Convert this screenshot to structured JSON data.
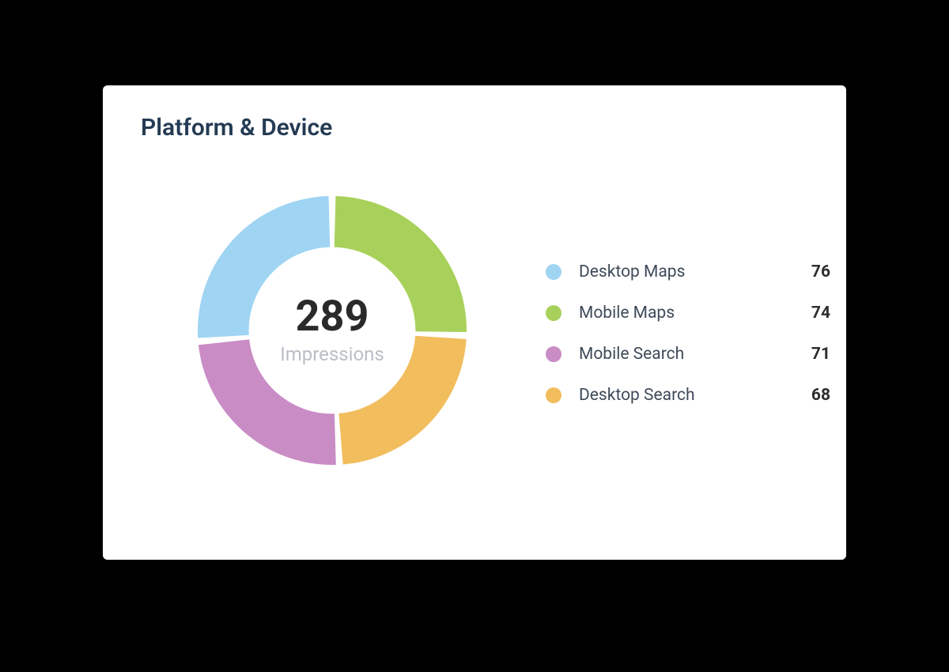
{
  "card": {
    "title": "Platform & Device",
    "center_value": "289",
    "center_label": "Impressions"
  },
  "legend": [
    {
      "label": "Desktop Maps",
      "value": "76",
      "color": "#9FD4F3"
    },
    {
      "label": "Mobile Maps",
      "value": "74",
      "color": "#A8D15B"
    },
    {
      "label": "Mobile Search",
      "value": "71",
      "color": "#C98CC5"
    },
    {
      "label": "Desktop Search",
      "value": "68",
      "color": "#F2BD5D"
    }
  ],
  "chart_data": {
    "type": "pie",
    "title": "Platform & Device",
    "subtitle": "Impressions",
    "total": 289,
    "categories": [
      "Desktop Maps",
      "Mobile Maps",
      "Mobile Search",
      "Desktop Search"
    ],
    "values": [
      76,
      74,
      71,
      68
    ],
    "colors": [
      "#9FD4F3",
      "#A8D15B",
      "#C98CC5",
      "#F2BD5D"
    ],
    "donut": true,
    "donut_inner_ratio": 0.62,
    "start_angle_deg": 0,
    "gap_deg": 3
  }
}
